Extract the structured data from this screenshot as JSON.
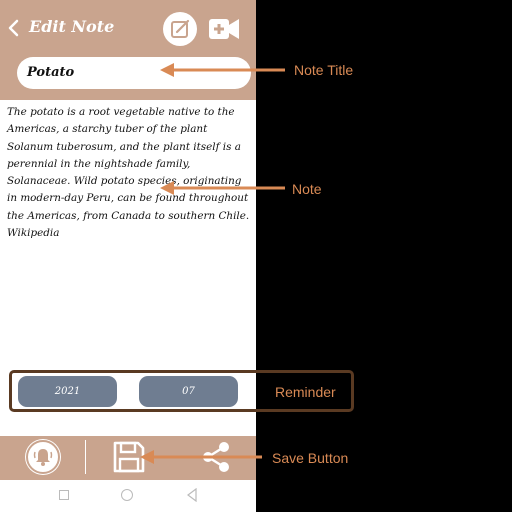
{
  "header": {
    "title": "Edit Note"
  },
  "note": {
    "title": "Potato",
    "body": "The potato is a root vegetable native to the Americas, a starchy tuber of the plant Solanum tuberosum, and the plant itself is a perennial in the nightshade family, Solanaceae. Wild potato species, originating in modern-day Peru, can be found throughout the Americas, from Canada to southern Chile. Wikipedia"
  },
  "reminder": {
    "year": "2021",
    "month": "07"
  },
  "annotations": {
    "note_title": "Note Title",
    "note": "Note",
    "reminder": "Reminder",
    "save_button": "Save  Button"
  },
  "colors": {
    "accent": "#c9a48e",
    "pill": "#6f7d91",
    "annotation": "#d98a55",
    "reminder_border": "#5a3a22"
  },
  "icons": [
    "back-icon",
    "edit-icon",
    "video-add-icon",
    "bell-icon",
    "save-icon",
    "share-icon"
  ]
}
